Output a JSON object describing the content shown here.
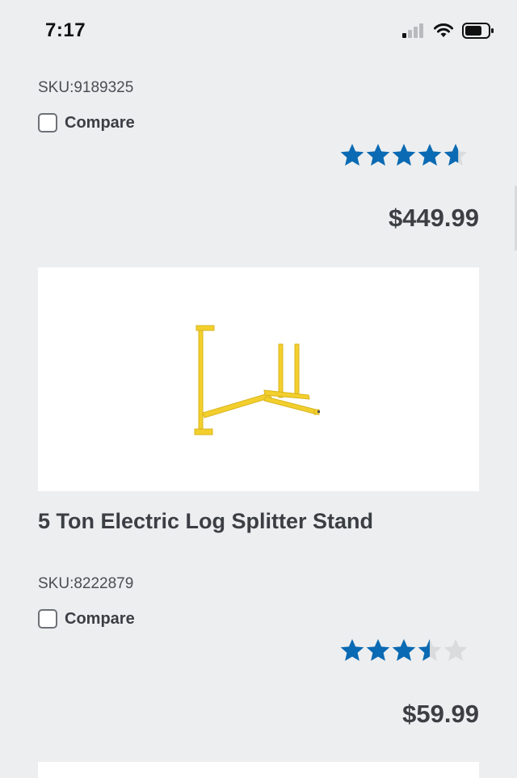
{
  "status": {
    "time": "7:17"
  },
  "items": [
    {
      "sku": "SKU:9189325",
      "compare_label": "Compare",
      "rating": 4.6,
      "price": "$449.99"
    },
    {
      "title": "5 Ton Electric Log Splitter Stand",
      "sku": "SKU:8222879",
      "compare_label": "Compare",
      "rating": 3.5,
      "price": "$59.99"
    }
  ],
  "colors": {
    "star": "#0a6ab3",
    "star_empty": "#d9dbdd",
    "product": "#f2cf2c"
  }
}
